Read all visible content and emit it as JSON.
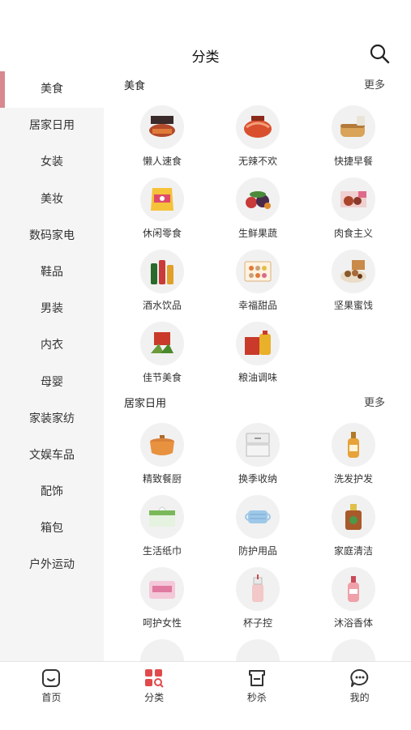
{
  "header": {
    "title": "分类"
  },
  "sidebar": {
    "items": [
      {
        "label": "美食"
      },
      {
        "label": "居家日用"
      },
      {
        "label": "女装"
      },
      {
        "label": "美妆"
      },
      {
        "label": "数码家电"
      },
      {
        "label": "鞋品"
      },
      {
        "label": "男装"
      },
      {
        "label": "内衣"
      },
      {
        "label": "母婴"
      },
      {
        "label": "家装家纺"
      },
      {
        "label": "文娱车品"
      },
      {
        "label": "配饰"
      },
      {
        "label": "箱包"
      },
      {
        "label": "户外运动"
      }
    ]
  },
  "sections": [
    {
      "title": "美食",
      "more": "更多",
      "items": [
        {
          "label": "懒人速食",
          "icon": "instant-food-icon"
        },
        {
          "label": "无辣不欢",
          "icon": "spicy-meat-icon"
        },
        {
          "label": "快捷早餐",
          "icon": "bread-icon"
        },
        {
          "label": "休闲零食",
          "icon": "snack-bag-icon"
        },
        {
          "label": "生鲜果蔬",
          "icon": "fruit-veg-icon"
        },
        {
          "label": "肉食主义",
          "icon": "meat-box-icon"
        },
        {
          "label": "酒水饮品",
          "icon": "drink-bottles-icon"
        },
        {
          "label": "幸福甜品",
          "icon": "dessert-box-icon"
        },
        {
          "label": "坚果蜜饯",
          "icon": "nuts-icon"
        },
        {
          "label": "佳节美食",
          "icon": "zongzi-icon"
        },
        {
          "label": "粮油调味",
          "icon": "oil-rice-icon"
        }
      ]
    },
    {
      "title": "居家日用",
      "more": "更多",
      "items": [
        {
          "label": "精致餐厨",
          "icon": "pot-icon"
        },
        {
          "label": "换季收纳",
          "icon": "storage-box-icon"
        },
        {
          "label": "洗发护发",
          "icon": "shampoo-icon"
        },
        {
          "label": "生活纸巾",
          "icon": "tissue-icon"
        },
        {
          "label": "防护用品",
          "icon": "mask-icon"
        },
        {
          "label": "家庭清洁",
          "icon": "cleaner-bottle-icon"
        },
        {
          "label": "呵护女性",
          "icon": "pad-pack-icon"
        },
        {
          "label": "杯子控",
          "icon": "cup-icon"
        },
        {
          "label": "沐浴香体",
          "icon": "body-wash-icon"
        }
      ]
    }
  ],
  "tabbar": {
    "items": [
      {
        "label": "首页",
        "icon": "home-face-icon"
      },
      {
        "label": "分类",
        "icon": "category-icon"
      },
      {
        "label": "秒杀",
        "icon": "flash-sale-icon"
      },
      {
        "label": "我的",
        "icon": "profile-chat-icon"
      }
    ]
  },
  "colors": {
    "accent": "#d8888e",
    "category_tab": "#e04a4a",
    "sidebar_bg": "#f5f5f5"
  }
}
